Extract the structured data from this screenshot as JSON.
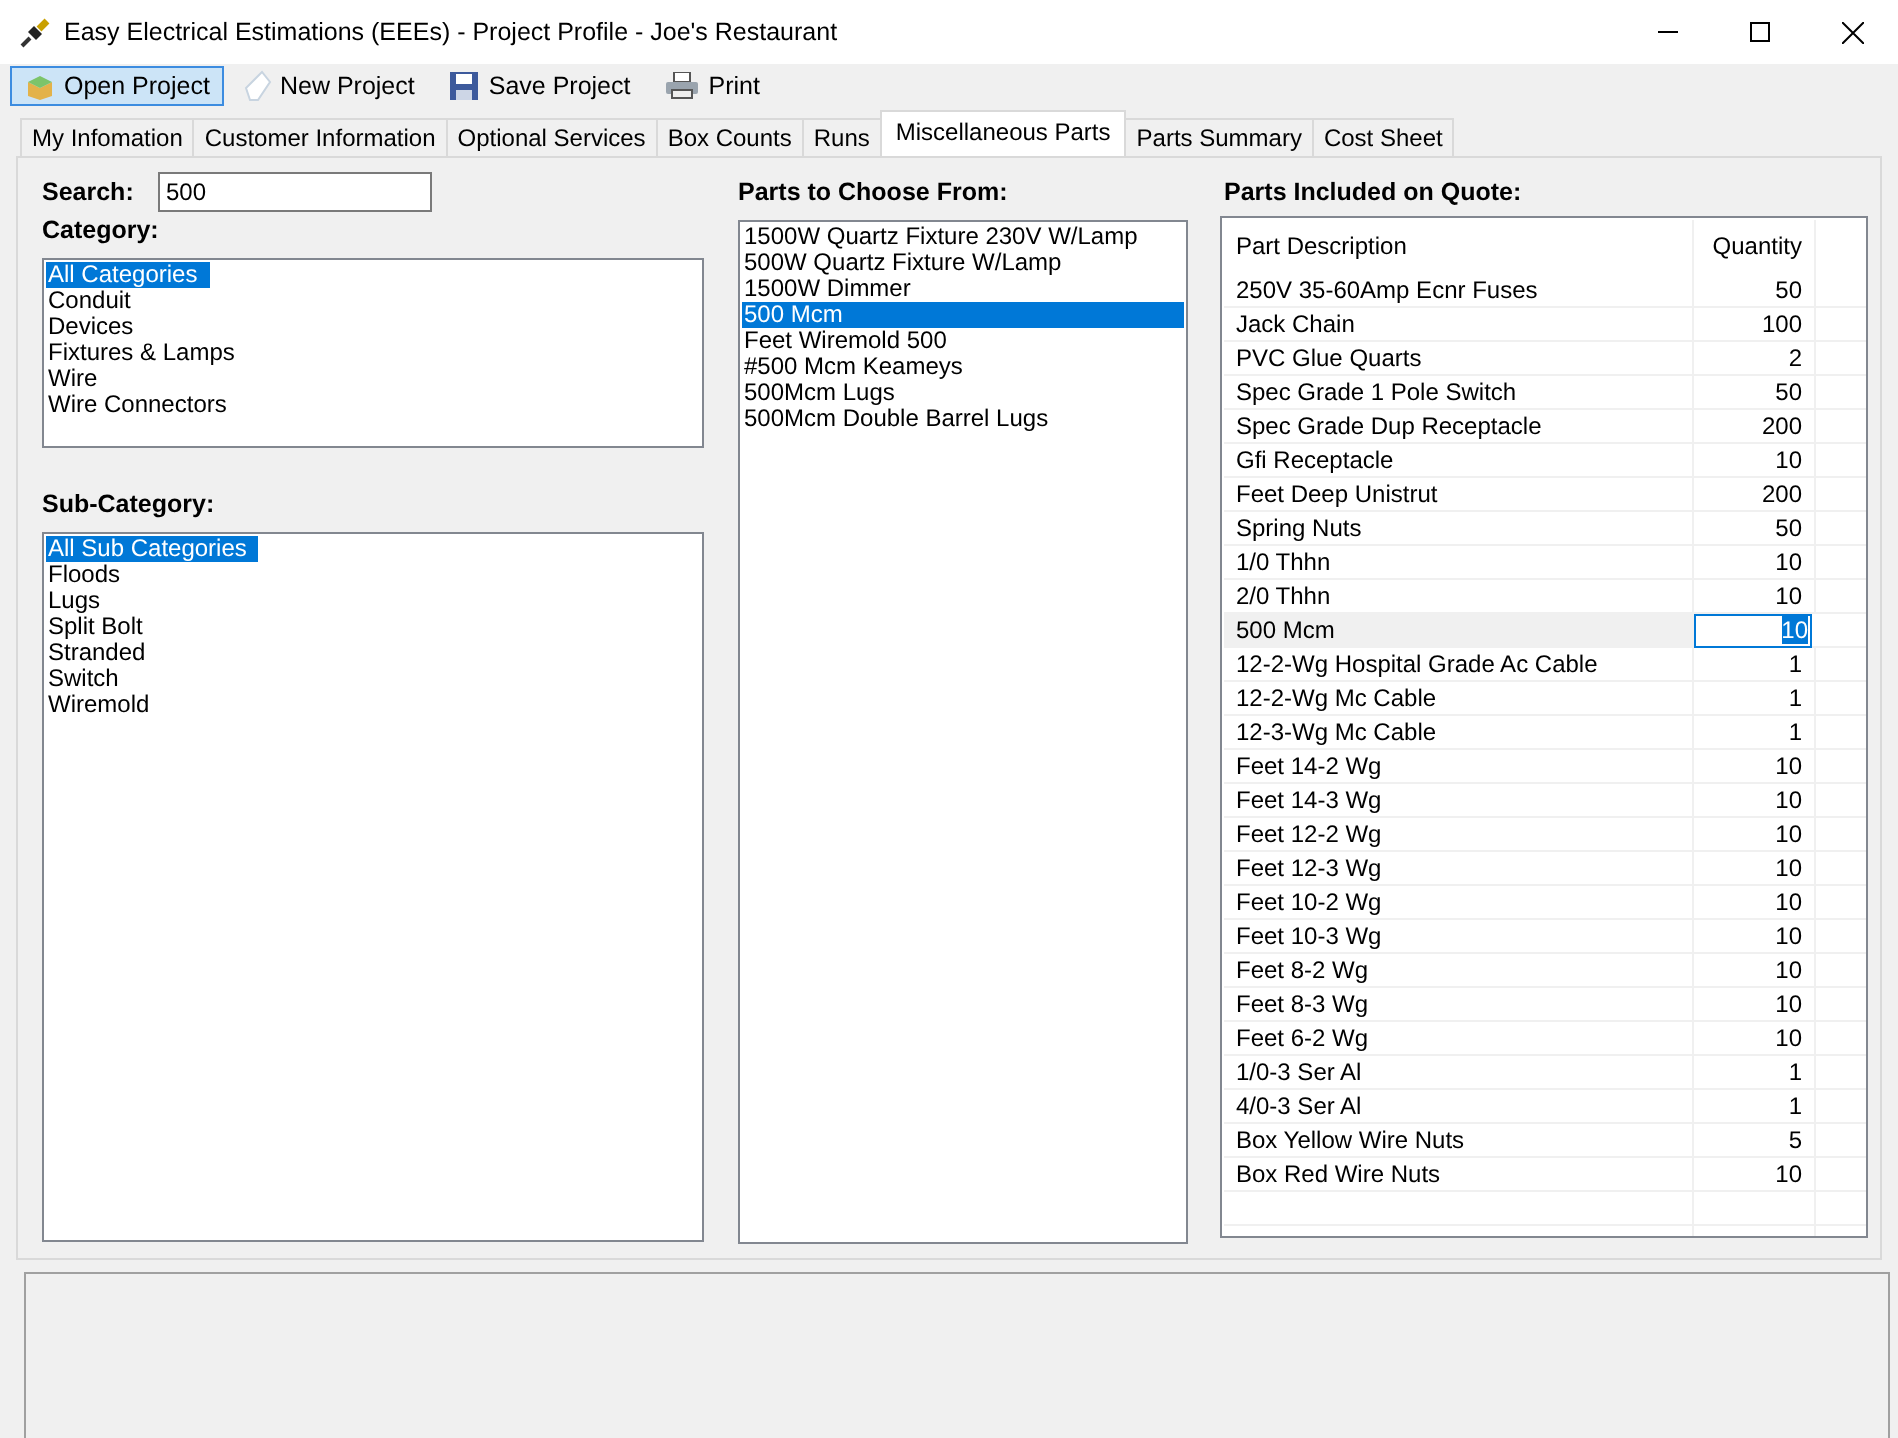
{
  "window": {
    "title": "Easy Electrical Estimations (EEEs) - Project Profile - Joe's Restaurant"
  },
  "toolbar": [
    {
      "kind": "open",
      "label": "Open Project",
      "selected": true
    },
    {
      "kind": "new",
      "label": "New Project",
      "selected": false
    },
    {
      "kind": "save",
      "label": "Save Project",
      "selected": false
    },
    {
      "kind": "print",
      "label": "Print",
      "selected": false
    }
  ],
  "tabs": [
    {
      "label": "My Infomation",
      "selected": false
    },
    {
      "label": "Customer Information",
      "selected": false
    },
    {
      "label": "Optional Services",
      "selected": false
    },
    {
      "label": "Box Counts",
      "selected": false
    },
    {
      "label": "Runs",
      "selected": false
    },
    {
      "label": "Miscellaneous Parts",
      "selected": true
    },
    {
      "label": "Parts Summary",
      "selected": false
    },
    {
      "label": "Cost Sheet",
      "selected": false
    }
  ],
  "search": {
    "label": "Search:",
    "value": "500"
  },
  "category": {
    "label": "Category:",
    "items": [
      {
        "label": "All Categories",
        "selected": true
      },
      {
        "label": "Conduit",
        "selected": false
      },
      {
        "label": "Devices",
        "selected": false
      },
      {
        "label": "Fixtures & Lamps",
        "selected": false
      },
      {
        "label": "Wire",
        "selected": false
      },
      {
        "label": "Wire Connectors",
        "selected": false
      }
    ]
  },
  "sub_category": {
    "label": "Sub-Category:",
    "items": [
      {
        "label": "All Sub Categories",
        "selected": true
      },
      {
        "label": "Floods",
        "selected": false
      },
      {
        "label": "Lugs",
        "selected": false
      },
      {
        "label": "Split Bolt",
        "selected": false
      },
      {
        "label": "Stranded",
        "selected": false
      },
      {
        "label": "Switch",
        "selected": false
      },
      {
        "label": "Wiremold",
        "selected": false
      }
    ]
  },
  "parts_to_choose": {
    "label": "Parts to Choose From:",
    "items": [
      {
        "label": "1500W Quartz Fixture 230V W/Lamp",
        "selected": false
      },
      {
        "label": "500W Quartz Fixture W/Lamp",
        "selected": false
      },
      {
        "label": "1500W Dimmer",
        "selected": false
      },
      {
        "label": "500 Mcm",
        "selected": true
      },
      {
        "label": "Feet Wiremold 500",
        "selected": false
      },
      {
        "label": "#500 Mcm Keameys",
        "selected": false
      },
      {
        "label": "500Mcm Lugs",
        "selected": false
      },
      {
        "label": "500Mcm Double Barrel Lugs",
        "selected": false
      }
    ]
  },
  "quote": {
    "label": "Parts Included on Quote:",
    "columns": [
      "Part Description",
      "Quantity"
    ],
    "rows": [
      {
        "description": "250V 35-60Amp Ecnr Fuses",
        "quantity": "50",
        "selected": false
      },
      {
        "description": "Jack Chain",
        "quantity": "100",
        "selected": false
      },
      {
        "description": "PVC Glue Quarts",
        "quantity": "2",
        "selected": false
      },
      {
        "description": "Spec Grade 1 Pole Switch",
        "quantity": "50",
        "selected": false
      },
      {
        "description": "Spec Grade Dup Receptacle",
        "quantity": "200",
        "selected": false
      },
      {
        "description": "Gfi Receptacle",
        "quantity": "10",
        "selected": false
      },
      {
        "description": "Feet Deep Unistrut",
        "quantity": "200",
        "selected": false
      },
      {
        "description": "Spring Nuts",
        "quantity": "50",
        "selected": false
      },
      {
        "description": "1/0 Thhn",
        "quantity": "10",
        "selected": false
      },
      {
        "description": "2/0 Thhn",
        "quantity": "10",
        "selected": false
      },
      {
        "description": "500 Mcm",
        "quantity": "10",
        "selected": true
      },
      {
        "description": "12-2-Wg Hospital Grade Ac Cable",
        "quantity": "1",
        "selected": false
      },
      {
        "description": "12-2-Wg Mc Cable",
        "quantity": "1",
        "selected": false
      },
      {
        "description": "12-3-Wg Mc Cable",
        "quantity": "1",
        "selected": false
      },
      {
        "description": "Feet 14-2 Wg",
        "quantity": "10",
        "selected": false
      },
      {
        "description": "Feet 14-3 Wg",
        "quantity": "10",
        "selected": false
      },
      {
        "description": "Feet 12-2 Wg",
        "quantity": "10",
        "selected": false
      },
      {
        "description": "Feet 12-3 Wg",
        "quantity": "10",
        "selected": false
      },
      {
        "description": "Feet 10-2 Wg",
        "quantity": "10",
        "selected": false
      },
      {
        "description": "Feet 10-3 Wg",
        "quantity": "10",
        "selected": false
      },
      {
        "description": "Feet 8-2 Wg",
        "quantity": "10",
        "selected": false
      },
      {
        "description": "Feet 8-3 Wg",
        "quantity": "10",
        "selected": false
      },
      {
        "description": "Feet 6-2 Wg",
        "quantity": "10",
        "selected": false
      },
      {
        "description": "1/0-3 Ser Al",
        "quantity": "1",
        "selected": false
      },
      {
        "description": "4/0-3 Ser Al",
        "quantity": "1",
        "selected": false
      },
      {
        "description": "Box Yellow Wire Nuts",
        "quantity": "5",
        "selected": false
      },
      {
        "description": "Box Red Wire Nuts",
        "quantity": "10",
        "selected": false
      }
    ]
  }
}
